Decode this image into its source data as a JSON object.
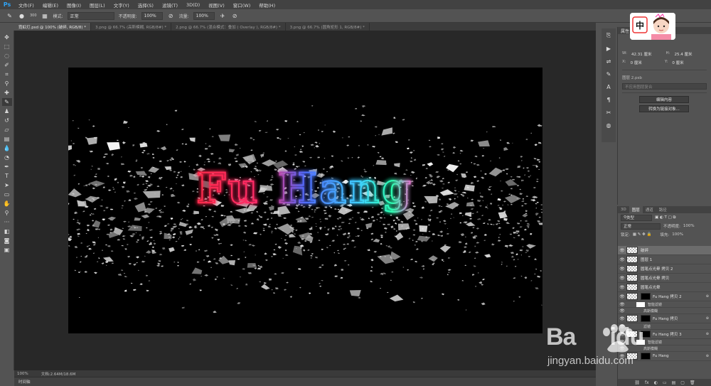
{
  "app": {
    "logo": "Ps"
  },
  "menu": [
    "文件(F)",
    "编辑(E)",
    "图像(I)",
    "图层(L)",
    "文字(Y)",
    "选择(S)",
    "滤镜(T)",
    "3D(D)",
    "视图(V)",
    "窗口(W)",
    "帮助(H)"
  ],
  "options": {
    "brush_size": "300",
    "mode_label": "模式:",
    "mode_value": "正常",
    "opacity_label": "不透明度:",
    "opacity_value": "100%",
    "flow_label": "流量:",
    "flow_value": "100%"
  },
  "tabs": [
    {
      "label": "霓虹灯.psd @ 100% (破碎, RGB/8) *",
      "active": true
    },
    {
      "label": "3.png @ 66.7% (高斯模糊, RGB/8#) *",
      "active": false
    },
    {
      "label": "2.png @ 66.7% (混合模式：叠加 ( Overlay ), RGB/8#) *",
      "active": false
    },
    {
      "label": "3.png @ 66.7% (圆角矩形 1, RGB/8#) *",
      "active": false
    }
  ],
  "canvas": {
    "headline": "Fu Hang",
    "colors": {
      "red": "#ff2a4a",
      "blue": "#4f6bff",
      "green": "#2affb0"
    }
  },
  "status": {
    "zoom": "100%",
    "doc": "文档:2.64M/18.6M"
  },
  "timeline": {
    "label": "时间轴"
  },
  "properties": {
    "title": "属性",
    "w_label": "W:",
    "w_value": "42.31 厘米",
    "h_label": "H:",
    "h_value": "25.4 厘米",
    "x_label": "X:",
    "x_value": "0 厘米",
    "y_label": "Y:",
    "y_value": "0 厘米",
    "layer_name": "图层 2.psb",
    "placeholder": "不应用图层复合",
    "btn_edit": "编辑内容",
    "btn_convert": "转换为链接对象..."
  },
  "layers_panel": {
    "tabs": [
      "3D",
      "图层",
      "通道",
      "路径"
    ],
    "kind_label": "类型",
    "blend_mode": "正常",
    "opacity_label": "不透明度:",
    "opacity_value": "100%",
    "lock_label": "锁定:",
    "fill_label": "填充:",
    "fill_value": "100%",
    "items": [
      {
        "name": "破碎",
        "type": "layer",
        "selected": true
      },
      {
        "name": "图层 1",
        "type": "layer",
        "selected": false
      },
      {
        "name": "圆笔点光晕 拷贝 2",
        "type": "layer",
        "selected": false
      },
      {
        "name": "圆笔点光晕 拷贝",
        "type": "layer",
        "selected": false
      },
      {
        "name": "圆笔点光晕",
        "type": "layer",
        "selected": false
      },
      {
        "name": "Fu Hang 拷贝 2",
        "type": "smart",
        "selected": false
      },
      {
        "name": "智能滤镜",
        "type": "sub",
        "selected": false
      },
      {
        "name": "高斯模糊",
        "type": "sub",
        "selected": false
      },
      {
        "name": "Fu Hang 拷贝",
        "type": "smart",
        "selected": false
      },
      {
        "name": "滤镜",
        "type": "sub",
        "selected": false
      },
      {
        "name": "Fu Hang 拷贝 3",
        "type": "smart",
        "selected": false
      },
      {
        "name": "智能滤镜",
        "type": "sub",
        "selected": false
      },
      {
        "name": "高斯模糊",
        "type": "sub",
        "selected": false
      },
      {
        "name": "Fu Hang",
        "type": "smart",
        "selected": false
      }
    ],
    "footer_icons": [
      "fx",
      "◐",
      "▭",
      "▤",
      "▢",
      "🗑"
    ]
  },
  "sticker": {
    "text": "中"
  },
  "watermark": {
    "brand": "Baidu",
    "url": "jingyan.baidu.com"
  }
}
